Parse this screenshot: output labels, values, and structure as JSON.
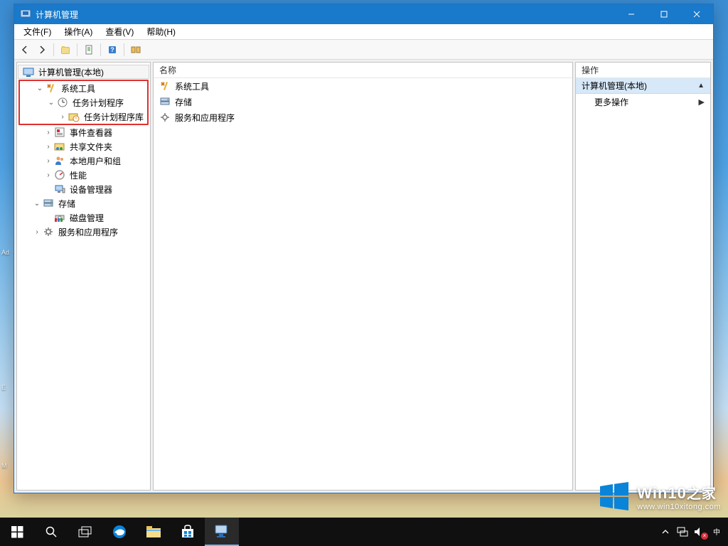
{
  "window": {
    "title": "计算机管理",
    "menu": {
      "file": "文件(F)",
      "action": "操作(A)",
      "view": "查看(V)",
      "help": "帮助(H)"
    }
  },
  "tree": {
    "root": "计算机管理(本地)",
    "system_tools": "系统工具",
    "task_scheduler": "任务计划程序",
    "task_scheduler_lib": "任务计划程序库",
    "event_viewer": "事件查看器",
    "shared_folders": "共享文件夹",
    "local_users": "本地用户和组",
    "performance": "性能",
    "device_manager": "设备管理器",
    "storage": "存储",
    "disk_management": "磁盘管理",
    "services_apps": "服务和应用程序"
  },
  "middle": {
    "header": "名称",
    "items": [
      {
        "key": "system_tools",
        "label": "系统工具"
      },
      {
        "key": "storage",
        "label": "存储"
      },
      {
        "key": "services_apps",
        "label": "服务和应用程序"
      }
    ]
  },
  "actions": {
    "header": "操作",
    "section": "计算机管理(本地)",
    "more": "更多操作"
  },
  "watermark": {
    "brand_en": "Win10",
    "brand_zh": "之家",
    "url": "www.win10xitong.com"
  },
  "colors": {
    "accent": "#1979ca",
    "redbox": "#e03030",
    "action_section_bg": "#d7e8f8"
  }
}
